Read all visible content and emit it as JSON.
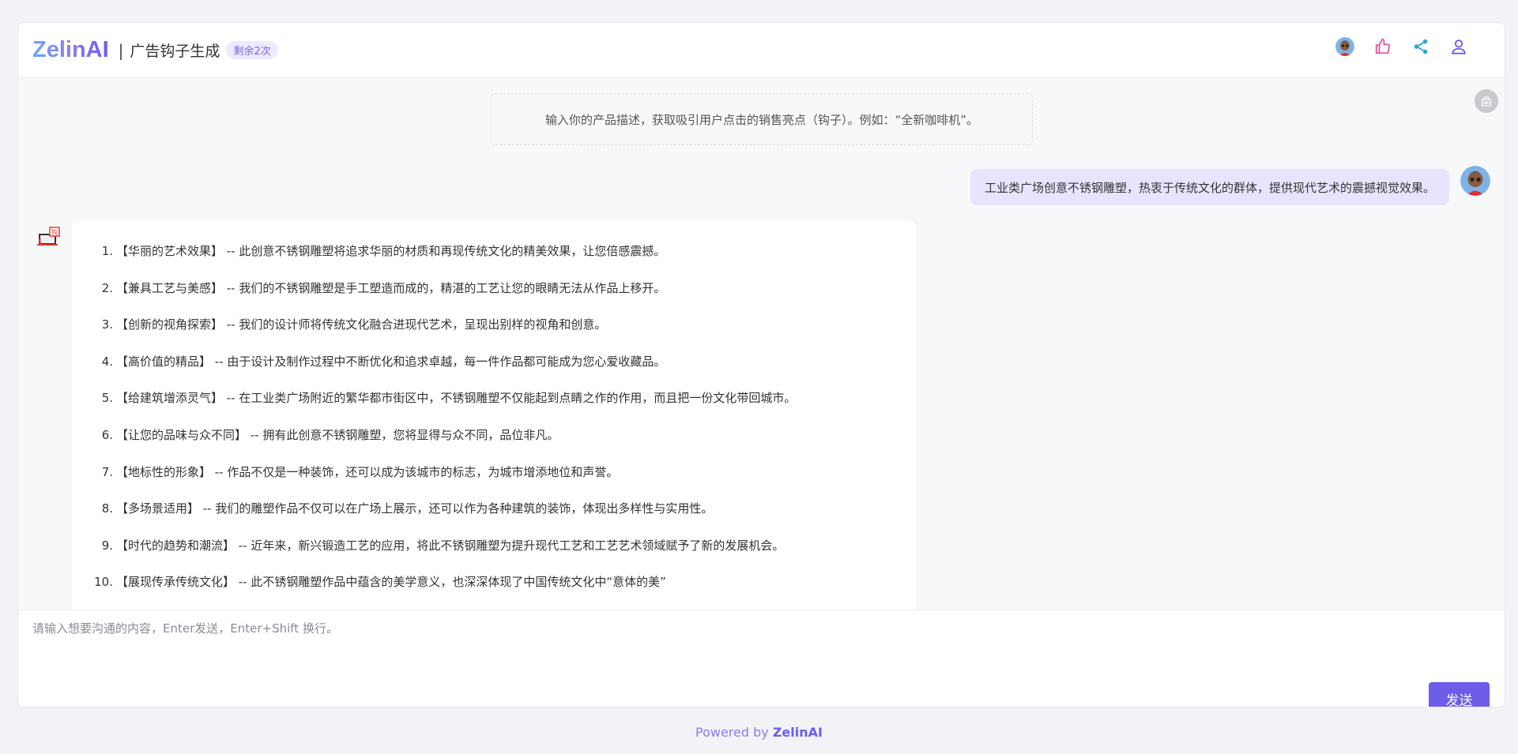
{
  "header": {
    "logo": "ZelinAI",
    "separator": "|",
    "title": "广告钩子生成",
    "quota": "剩余2次",
    "actions": [
      "avatar-icon",
      "thumbs-up-icon",
      "share-icon",
      "user-icon"
    ]
  },
  "chat": {
    "hint": "输入你的产品描述，获取吸引用户点击的销售亮点（钩子）。例如：“全新咖啡机”。",
    "user_message": "工业类广场创意不锈钢雕塑，热衷于传统文化的群体，提供现代艺术的震撼视觉效果。",
    "bot_items": [
      {
        "num": "1.",
        "text": "【华丽的艺术效果】 -- 此创意不锈钢雕塑将追求华丽的材质和再现传统文化的精美效果，让您倍感震撼。"
      },
      {
        "num": "2.",
        "text": "【兼具工艺与美感】 -- 我们的不锈钢雕塑是手工塑造而成的，精湛的工艺让您的眼睛无法从作品上移开。"
      },
      {
        "num": "3.",
        "text": "【创新的视角探索】 -- 我们的设计师将传统文化融合进现代艺术，呈现出别样的视角和创意。"
      },
      {
        "num": "4.",
        "text": "【高价值的精品】 -- 由于设计及制作过程中不断优化和追求卓越，每一件作品都可能成为您心爱收藏品。"
      },
      {
        "num": "5.",
        "text": "【给建筑增添灵气】 -- 在工业类广场附近的繁华都市街区中，不锈钢雕塑不仅能起到点睛之作的作用，而且把一份文化带回城市。"
      },
      {
        "num": "6.",
        "text": "【让您的品味与众不同】 -- 拥有此创意不锈钢雕塑，您将显得与众不同，品位非凡。"
      },
      {
        "num": "7.",
        "text": "【地标性的形象】 -- 作品不仅是一种装饰，还可以成为该城市的标志，为城市增添地位和声誉。"
      },
      {
        "num": "8.",
        "text": "【多场景适用】 -- 我们的雕塑作品不仅可以在广场上展示，还可以作为各种建筑的装饰，体现出多样性与实用性。"
      },
      {
        "num": "9.",
        "text": "【时代的趋势和潮流】 -- 近年来，新兴锻造工艺的应用，将此不锈钢雕塑为提升现代工艺和工艺艺术领域赋予了新的发展机会。"
      },
      {
        "num": "10.",
        "text": "【展现传承传统文化】 -- 此不锈钢雕塑作品中蕴含的美学意义，也深深体现了中国传统文化中“意体的美”"
      }
    ]
  },
  "input": {
    "placeholder": "请输入想要沟通的内容，Enter发送，Enter+Shift 换行。",
    "value": "",
    "send_label": "发送"
  },
  "footer": {
    "powered_prefix": "Powered by ",
    "brand": "ZelinAI"
  },
  "colors": {
    "accent": "#6c5ce7",
    "user_bubble": "#e8e4fd",
    "like": "#e8559b",
    "share": "#2aa3d6"
  }
}
